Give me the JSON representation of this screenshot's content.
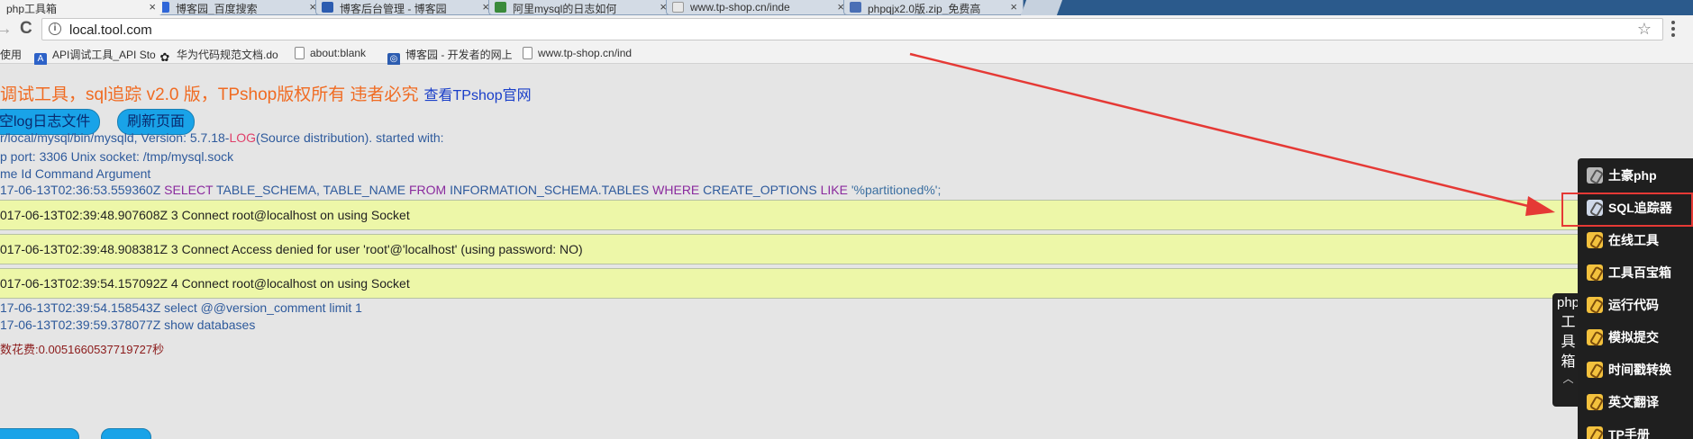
{
  "tabs": [
    {
      "label": "php工具箱",
      "color": "#3b6fc9",
      "active": true
    },
    {
      "label": "博客园_百度搜索",
      "color": "#2f66d8"
    },
    {
      "label": "博客后台管理 - 博客园",
      "color": "#2c5cb0"
    },
    {
      "label": "阿里mysql的日志如何",
      "color": "#3a8a3a"
    },
    {
      "label": "www.tp-shop.cn/inde",
      "color": "#bbbbbb"
    },
    {
      "label": "phpqjx2.0版.zip_免费高",
      "color": "#4a6fb5"
    }
  ],
  "tab_close_glyph": "×",
  "toolbar": {
    "back_glyph": "→",
    "reload_glyph": "C",
    "info_glyph": "i",
    "url": "local.tool.com",
    "star_glyph": "☆"
  },
  "bookmarks": [
    {
      "label": "使用",
      "icon_color": "#f2f2f2",
      "glyph": ""
    },
    {
      "label": "API调试工具_API Sto",
      "icon_color": "#2d62c8",
      "glyph": "A"
    },
    {
      "label": "华为代码规范文档.do",
      "icon_color": "#222222",
      "glyph": "✿"
    },
    {
      "label": "about:blank",
      "icon_color": "#ffffff",
      "glyph": ""
    },
    {
      "label": "博客园 - 开发者的网上",
      "icon_color": "#2c5cb0",
      "glyph": "◎"
    },
    {
      "label": "www.tp-shop.cn/ind",
      "icon_color": "#ffffff",
      "glyph": ""
    }
  ],
  "page": {
    "title": "调试工具，sql追踪 v2.0 版，TPshop版权所有 违者必究",
    "site_link": "查看TPshop官网",
    "clear_log_button": "空log日志文件",
    "refresh_button": "刷新页面",
    "log_header": [
      {
        "pre": "r/local/mysql/bin/mysqld, Version: 5.7.18-",
        "kw": "LOG",
        "post": "(Source distribution). started with:"
      },
      {
        "pre": "p port: 3306 Unix socket: /tmp/mysql.sock",
        "kw": "",
        "post": ""
      },
      {
        "pre": "me Id Command Argument",
        "kw": "",
        "post": ""
      }
    ],
    "sql_line": {
      "time": "17-06-13T02:36:53.559360Z",
      "k1": "SELECT",
      "p1": "TABLE_SCHEMA, TABLE_NAME",
      "k2": "FROM",
      "p2": "INFORMATION_SCHEMA.TABLES",
      "k3": "WHERE",
      "p3": "CREATE_OPTIONS",
      "k4": "LIKE",
      "p4": "'%partitioned%';"
    },
    "highlighted_lines": [
      "017-06-13T02:39:48.907608Z 3 Connect root@localhost on using Socket",
      "017-06-13T02:39:48.908381Z 3 Connect Access denied for user 'root'@'localhost' (using password: NO)",
      "017-06-13T02:39:54.157092Z 4 Connect root@localhost on using Socket"
    ],
    "tail_lines": [
      "17-06-13T02:39:54.158543Z select @@version_comment limit 1",
      "17-06-13T02:39:59.378077Z show databases"
    ],
    "cost": "数花费:0.0051660537719727秒"
  },
  "toolbox": {
    "tab_lines": [
      "php",
      "工",
      "具",
      "箱"
    ],
    "collapse_glyph": "︿",
    "items": [
      {
        "label": "土豪php",
        "icon": "tools-icon",
        "style": "gray"
      },
      {
        "label": "SQL追踪器",
        "icon": "grid-icon",
        "style": "grid"
      },
      {
        "label": "在线工具",
        "icon": "pencil-icon",
        "style": ""
      },
      {
        "label": "工具百宝箱",
        "icon": "pencil-icon",
        "style": ""
      },
      {
        "label": "运行代码",
        "icon": "pencil-icon",
        "style": ""
      },
      {
        "label": "模拟提交",
        "icon": "pencil-icon",
        "style": ""
      },
      {
        "label": "时间戳转换",
        "icon": "pencil-icon",
        "style": ""
      },
      {
        "label": "英文翻译",
        "icon": "pencil-icon",
        "style": ""
      },
      {
        "label": "TP手册",
        "icon": "pencil-icon",
        "style": ""
      }
    ]
  },
  "colors": {
    "title": "#f06b22",
    "pill": "#19a3e8",
    "highlight": "#edf7a8",
    "annotation": "#e53935",
    "panel": "#1f1f1f"
  }
}
